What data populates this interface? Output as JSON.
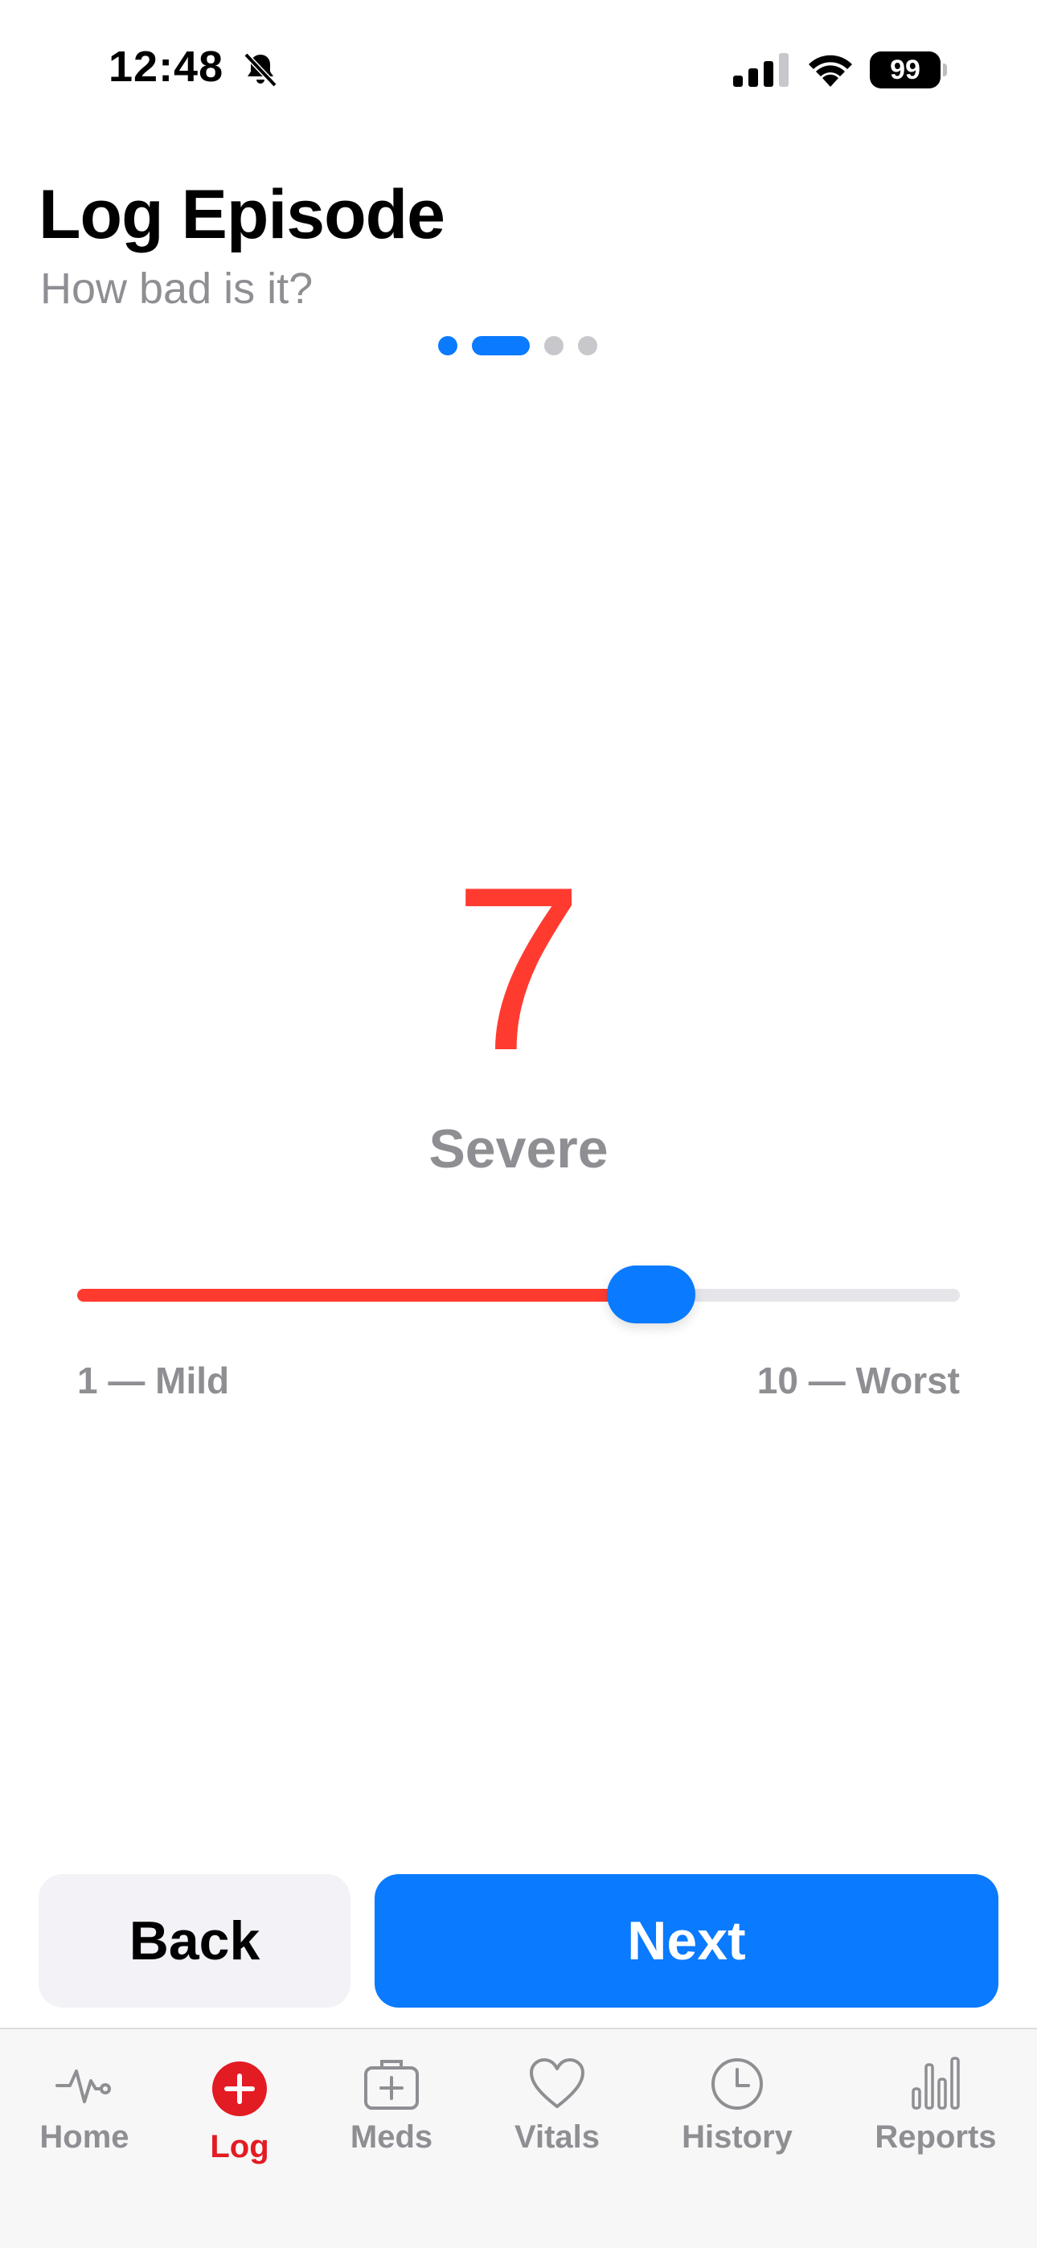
{
  "status_bar": {
    "time": "12:48",
    "battery": "99",
    "icons": [
      "bell-slash-icon",
      "cellular-signal-icon",
      "wifi-icon",
      "battery-icon"
    ]
  },
  "header": {
    "title": "Log Episode",
    "subtitle": "How bad is it?",
    "steps": {
      "total": 4,
      "current": 2
    }
  },
  "severity": {
    "value": "7",
    "label": "Severe",
    "min": 1,
    "max": 10,
    "min_label": "1 — Mild",
    "max_label": "10 — Worst",
    "color": "#ff3b30"
  },
  "actions": {
    "back_label": "Back",
    "next_label": "Next"
  },
  "tab_bar": {
    "items": [
      {
        "label": "Home",
        "icon": "heartbeat-icon",
        "active": false
      },
      {
        "label": "Log",
        "icon": "plus-circle-icon",
        "active": true
      },
      {
        "label": "Meds",
        "icon": "medkit-icon",
        "active": false
      },
      {
        "label": "Vitals",
        "icon": "heart-icon",
        "active": false
      },
      {
        "label": "History",
        "icon": "clock-icon",
        "active": false
      },
      {
        "label": "Reports",
        "icon": "bar-chart-icon",
        "active": false
      }
    ]
  },
  "colors": {
    "accent": "#0a7aff",
    "danger": "#ff3b30",
    "active_tab": "#e31b23",
    "secondary_text": "#8e8e93"
  }
}
